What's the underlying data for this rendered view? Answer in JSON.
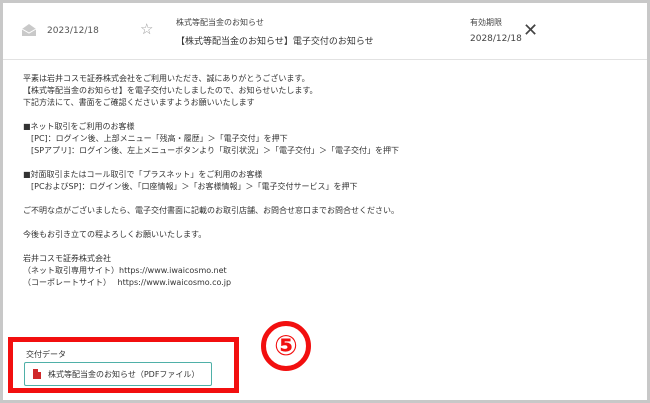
{
  "header": {
    "date": "2023/12/18",
    "category": "株式等配当金のお知らせ",
    "subject": "【株式等配当金のお知らせ】電子交付のお知らせ",
    "expiry_label": "有効期限",
    "expiry_date": "2028/12/18",
    "close_glyph": "✕",
    "star_glyph": "☆"
  },
  "body": {
    "lines": [
      "平素は岩井コスモ証券株式会社をご利用いただき、誠にありがとうございます。",
      "【株式等配当金のお知らせ】を電子交付いたしましたので、お知らせいたします。",
      "下記方法にて、書面をご確認くださいますようお願いいたします",
      "",
      "■ネット取引をご利用のお客様",
      "　[PC]：ログイン後、上部メニュー「残高・履歴」＞「電子交付」を押下",
      "　[SPアプリ]：ログイン後、左上メニューボタンより「取引状況」＞「電子交付」＞「電子交付」を押下",
      "",
      "■対面取引またはコール取引で「プラスネット」をご利用のお客様",
      "　[PCおよびSP]：ログイン後、「口座情報」＞「お客様情報」＞「電子交付サービス」を押下",
      "",
      "ご不明な点がございましたら、電子交付書面に記載のお取引店舗、お問合せ窓口までお問合せください。",
      "",
      "今後もお引き立ての程よろしくお願いいたします。",
      "",
      "岩井コスモ証券株式会社",
      "（ネット取引専用サイト）https://www.iwaicosmo.net",
      "（コーポレートサイト）　 https://www.iwaicosmo.co.jp"
    ]
  },
  "attachment": {
    "label": "交付データ",
    "button_text": "株式等配当金のお知らせ（PDFファイル）"
  },
  "annotation": {
    "step_number": "⑤",
    "color": "#f20f0f"
  }
}
